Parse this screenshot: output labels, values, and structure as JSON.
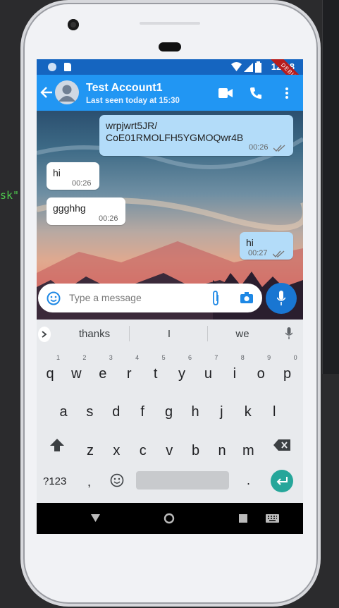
{
  "ide": {
    "code_fragment": "sk\","
  },
  "status_bar": {
    "time": "12:28"
  },
  "app_bar": {
    "contact_name": "Test Account1",
    "last_seen": "Last seen today at 15:30",
    "debug_banner": "DEBUG"
  },
  "messages": [
    {
      "direction": "out",
      "line1": "wrpjwrt5JR/",
      "line2": "CoE01RMOLFH5YGMOQwr4B",
      "time": "00:26"
    },
    {
      "direction": "in",
      "text": "hi",
      "time": "00:26"
    },
    {
      "direction": "in",
      "text": "ggghhg",
      "time": "00:26"
    },
    {
      "direction": "out",
      "text": "hi",
      "time": "00:27"
    }
  ],
  "composer": {
    "placeholder": "Type a message"
  },
  "keyboard": {
    "suggestions": [
      "thanks",
      "I",
      "we"
    ],
    "row1": [
      [
        "q",
        "1"
      ],
      [
        "w",
        "2"
      ],
      [
        "e",
        "3"
      ],
      [
        "r",
        "4"
      ],
      [
        "t",
        "5"
      ],
      [
        "y",
        "6"
      ],
      [
        "u",
        "7"
      ],
      [
        "i",
        "8"
      ],
      [
        "o",
        "9"
      ],
      [
        "p",
        "0"
      ]
    ],
    "row2": [
      "a",
      "s",
      "d",
      "f",
      "g",
      "h",
      "j",
      "k",
      "l"
    ],
    "row3": [
      "z",
      "x",
      "c",
      "v",
      "b",
      "n",
      "m"
    ],
    "symbols_label": "?123",
    "comma": ",",
    "period": "."
  },
  "colors": {
    "app_bar": "#2196f3",
    "status_bar": "#1565c0",
    "outgoing_bubble": "#b3dcf9",
    "mic_button": "#1976d2",
    "enter_key": "#26a69a"
  },
  "icons": [
    "back-arrow-icon",
    "video-call-icon",
    "phone-icon",
    "more-vert-icon",
    "emoji-icon",
    "attach-icon",
    "camera-icon",
    "mic-icon",
    "double-check-icon",
    "shift-icon",
    "backspace-icon",
    "enter-icon",
    "mic-suggest-icon",
    "chevron-right-icon",
    "nav-back-icon",
    "nav-home-icon",
    "nav-recents-icon",
    "nav-keyboard-icon"
  ]
}
